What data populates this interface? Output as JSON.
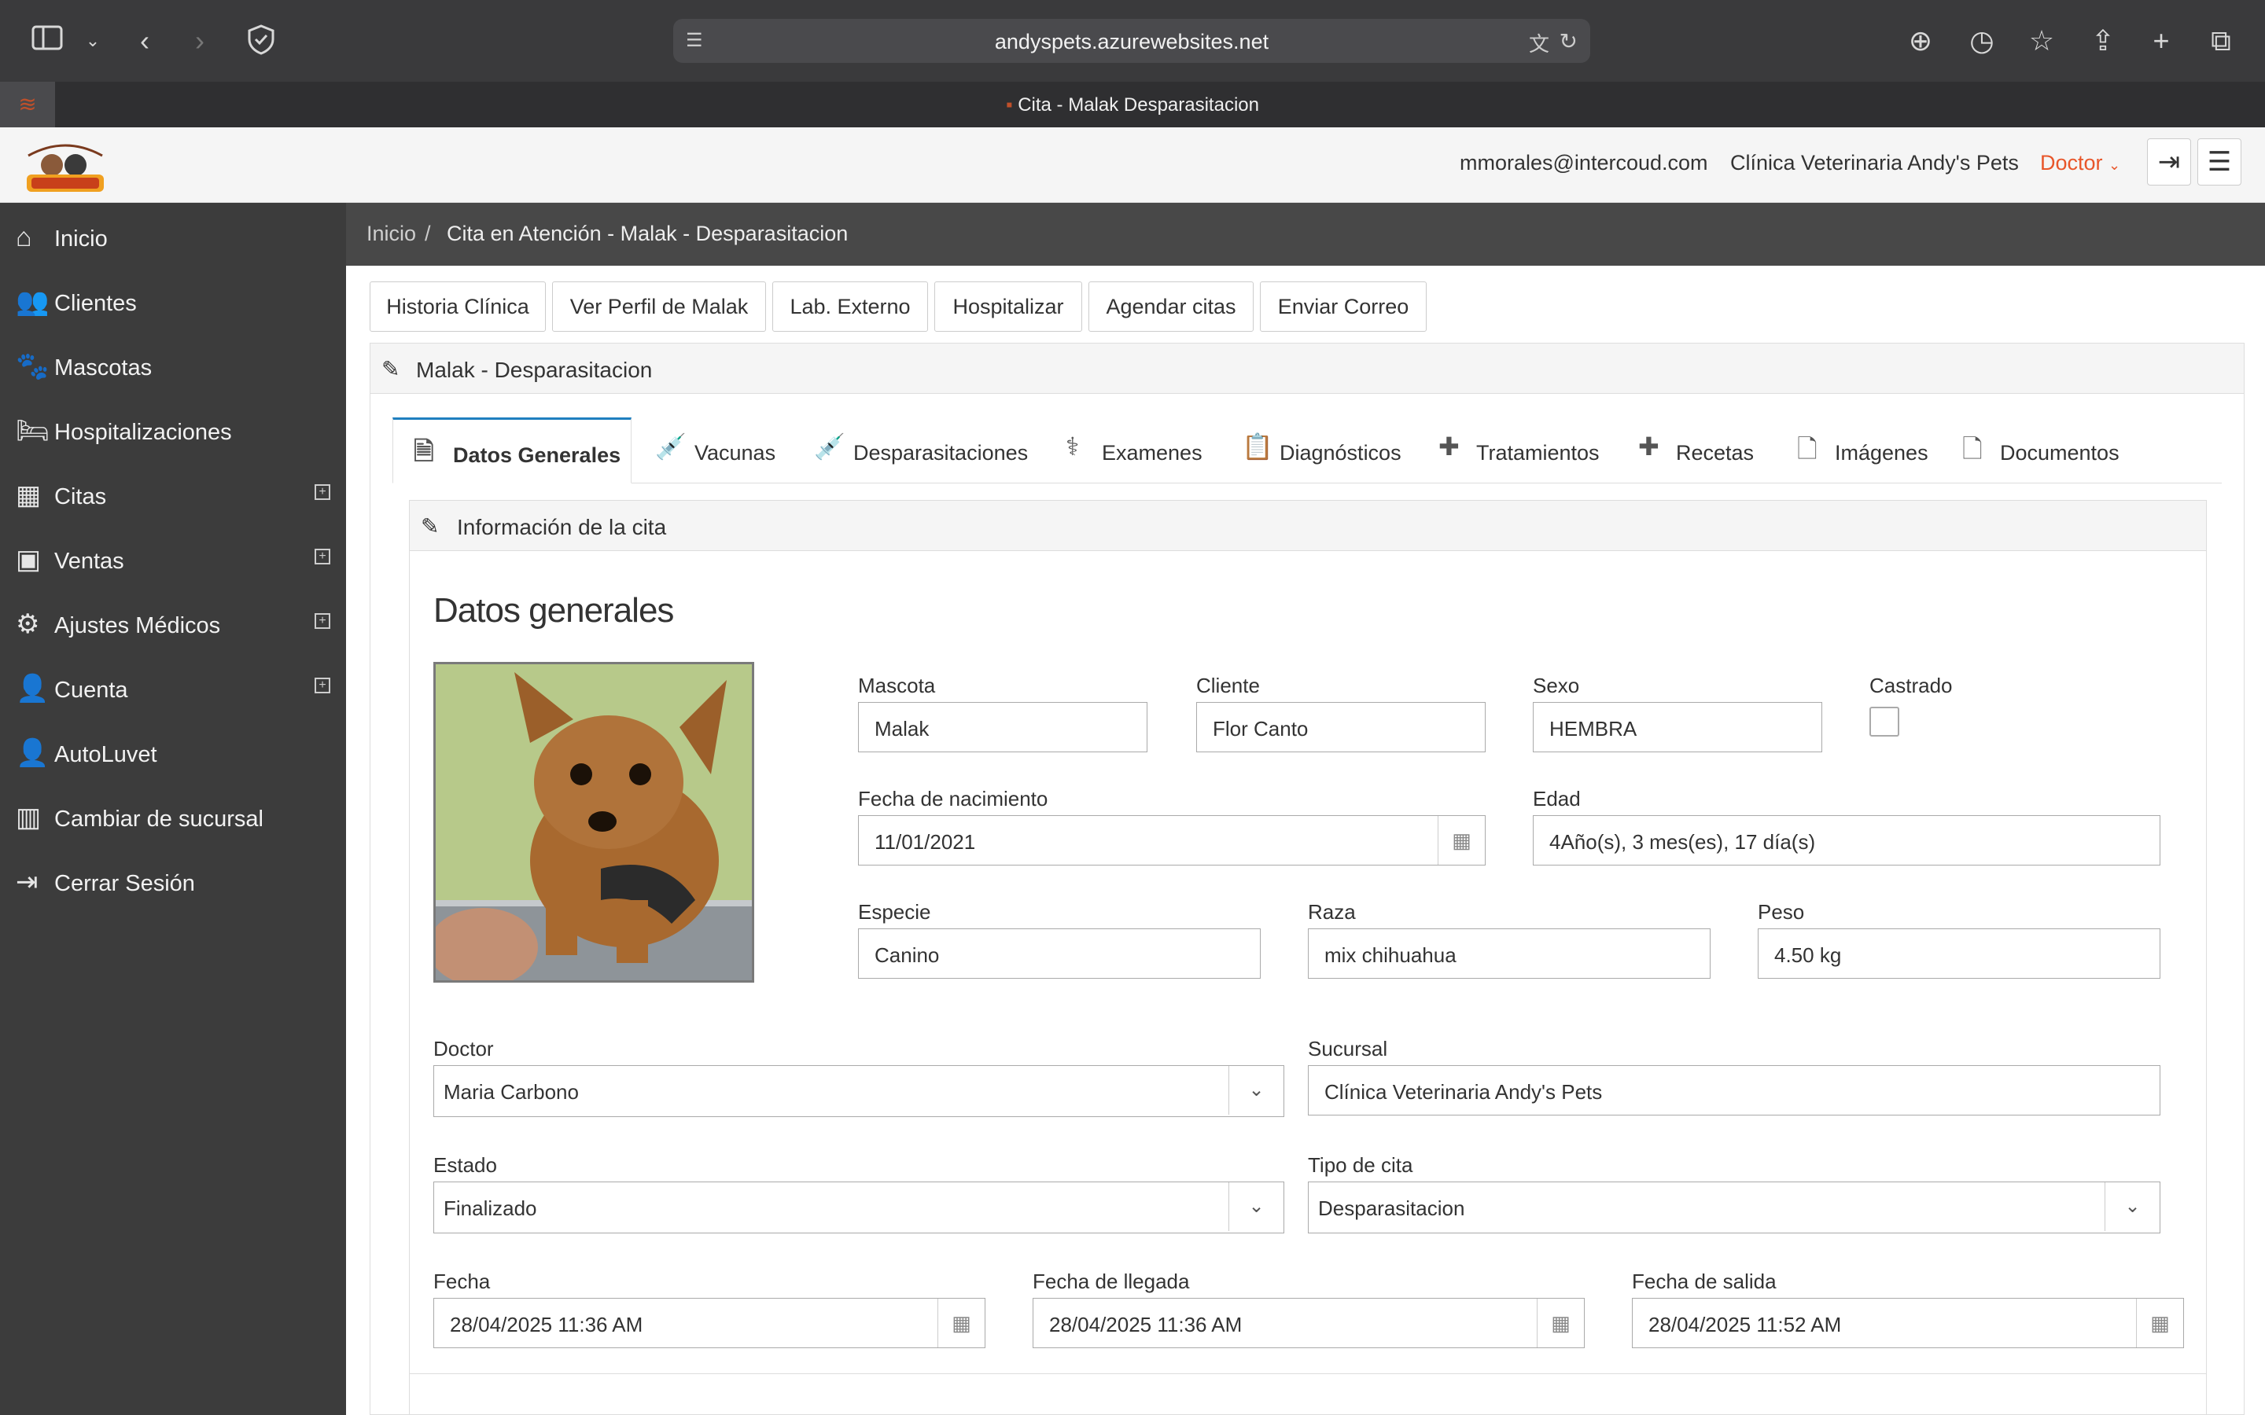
{
  "browser": {
    "url": "andyspets.azurewebsites.net",
    "tab_title": "Cita - Malak Desparasitacion"
  },
  "header": {
    "email": "mmorales@intercoud.com",
    "clinic": "Clínica Veterinaria Andy's Pets",
    "role": "Doctor"
  },
  "sidebar": {
    "items": [
      {
        "label": "Inicio",
        "icon": "home-icon"
      },
      {
        "label": "Clientes",
        "icon": "users-icon"
      },
      {
        "label": "Mascotas",
        "icon": "paw-icon"
      },
      {
        "label": "Hospitalizaciones",
        "icon": "bed-icon"
      },
      {
        "label": "Citas",
        "icon": "calendar-icon"
      },
      {
        "label": "Ventas",
        "icon": "money-icon"
      },
      {
        "label": "Ajustes Médicos",
        "icon": "gear-icon"
      },
      {
        "label": "Cuenta",
        "icon": "user-icon"
      },
      {
        "label": "AutoLuvet",
        "icon": "user-add-icon"
      },
      {
        "label": "Cambiar de sucursal",
        "icon": "building-icon"
      },
      {
        "label": "Cerrar Sesión",
        "icon": "logout-icon"
      }
    ]
  },
  "breadcrumb": {
    "home": "Inicio",
    "separator": "/",
    "current": "Cita en Atención - Malak - Desparasitacion"
  },
  "actions": {
    "historia": "Historia Clínica",
    "perfil": "Ver Perfil de Malak",
    "lab": "Lab. Externo",
    "hospitalizar": "Hospitalizar",
    "agendar": "Agendar citas",
    "correo": "Enviar Correo"
  },
  "panel": {
    "title": "Malak - Desparasitacion"
  },
  "tabs": {
    "datos": "Datos Generales",
    "vacunas": "Vacunas",
    "desparasitaciones": "Desparasitaciones",
    "examenes": "Examenes",
    "diagnosticos": "Diagnósticos",
    "tratamientos": "Tratamientos",
    "recetas": "Recetas",
    "imagenes": "Imágenes",
    "documentos": "Documentos"
  },
  "info": {
    "header": "Información de la cita",
    "section_title": "Datos generales"
  },
  "form": {
    "mascota": {
      "label": "Mascota",
      "value": "Malak"
    },
    "cliente": {
      "label": "Cliente",
      "value": "Flor Canto"
    },
    "sexo": {
      "label": "Sexo",
      "value": "HEMBRA"
    },
    "castrado": {
      "label": "Castrado",
      "checked": false
    },
    "nacimiento": {
      "label": "Fecha de nacimiento",
      "value": "11/01/2021"
    },
    "edad": {
      "label": "Edad",
      "value": "4Año(s), 3 mes(es), 17 día(s)"
    },
    "especie": {
      "label": "Especie",
      "value": "Canino"
    },
    "raza": {
      "label": "Raza",
      "value": "mix chihuahua"
    },
    "peso": {
      "label": "Peso",
      "value": "4.50 kg"
    },
    "doctor": {
      "label": "Doctor",
      "value": "Maria Carbono"
    },
    "sucursal": {
      "label": "Sucursal",
      "value": "Clínica Veterinaria Andy's Pets"
    },
    "estado": {
      "label": "Estado",
      "value": "Finalizado"
    },
    "tipo": {
      "label": "Tipo de cita",
      "value": "Desparasitacion"
    },
    "fecha": {
      "label": "Fecha",
      "value": "28/04/2025 11:36 AM"
    },
    "llegada": {
      "label": "Fecha de llegada",
      "value": "28/04/2025 11:36 AM"
    },
    "salida": {
      "label": "Fecha de salida",
      "value": "28/04/2025 11:52 AM"
    }
  },
  "colors": {
    "sidebar_bg": "#3c3c3c",
    "breadcrumb_bg": "#484848",
    "accent_role": "#e8562a",
    "tab_active_border": "#1f7fbf"
  }
}
